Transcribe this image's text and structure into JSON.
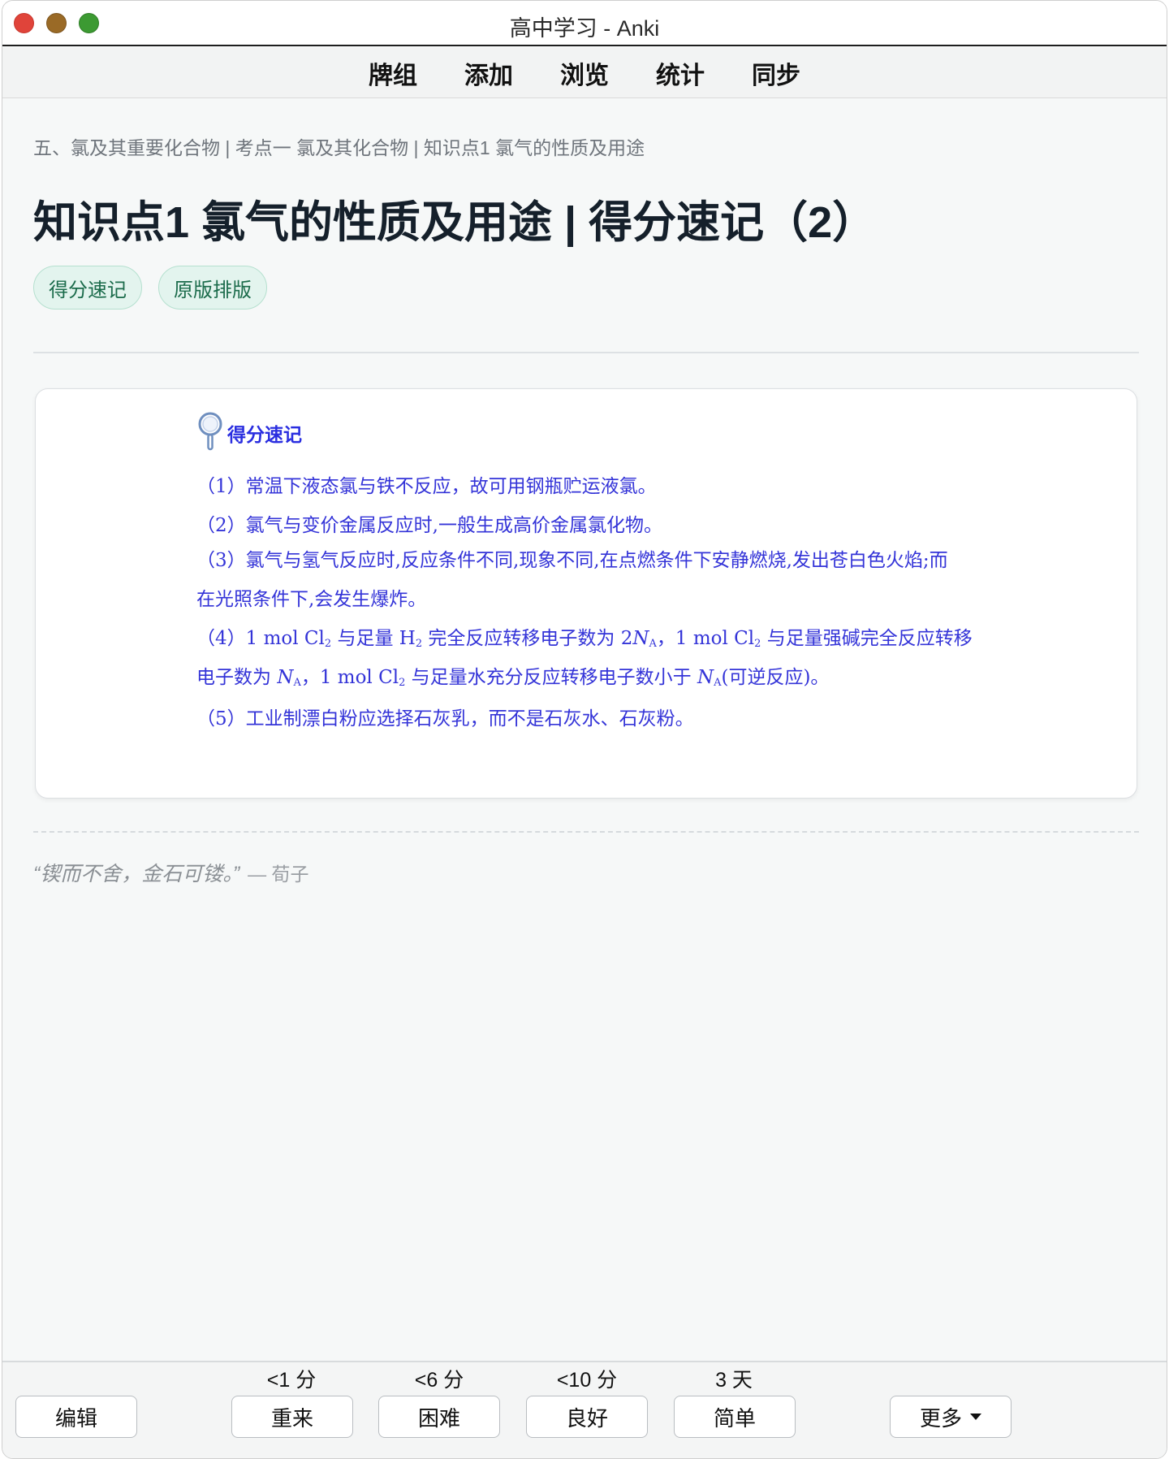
{
  "window": {
    "title": "高中学习 - Anki"
  },
  "toolbar": {
    "items": [
      "牌组",
      "添加",
      "浏览",
      "统计",
      "同步"
    ]
  },
  "breadcrumb": "五、氯及其重要化合物 | 考点一 氯及其化合物 | 知识点1 氯气的性质及用途",
  "page_title": "知识点1 氯气的性质及用途 | 得分速记（2）",
  "tags": [
    "得分速记",
    "原版排版"
  ],
  "card": {
    "heading": "得分速记",
    "lines": {
      "l1": "（1）常温下液态氯与铁不反应，故可用钢瓶贮运液氯。",
      "l2": "（2）氯气与变价金属反应时,一般生成高价金属氯化物。",
      "l3": "（3）氯气与氢气反应时,反应条件不同,现象不同,在点燃条件下安静燃烧,发出苍白色火焰;而",
      "l4": "在光照条件下,会发生爆炸。",
      "l5a": "（4）1 mol Cl",
      "l5b": "2",
      "l5c": " 与足量 H",
      "l5d": "2",
      "l5e": " 完全反应转移电子数为 2",
      "l5f": "N",
      "l5g": "A",
      "l5h": "，1 mol Cl",
      "l5i": "2",
      "l5j": " 与足量强碱完全反应转移",
      "l6a": "电子数为 ",
      "l6b": "N",
      "l6c": "A",
      "l6d": "，1 mol Cl",
      "l6e": "2",
      "l6f": " 与足量水充分反应转移电子数小于 ",
      "l6g": "N",
      "l6h": "A",
      "l6i": "(可逆反应)。",
      "l7": "（5）工业制漂白粉应选择石灰乳，而不是石灰水、石灰粉。"
    }
  },
  "quote": {
    "text": "“锲而不舍，金石可镂。”",
    "author": "— 荀子"
  },
  "bottombar": {
    "edit": "编辑",
    "answers": [
      {
        "interval": "<1 分",
        "label": "重来"
      },
      {
        "interval": "<6 分",
        "label": "困难"
      },
      {
        "interval": "<10 分",
        "label": "良好"
      },
      {
        "interval": "3 天",
        "label": "简单"
      }
    ],
    "more": "更多"
  }
}
